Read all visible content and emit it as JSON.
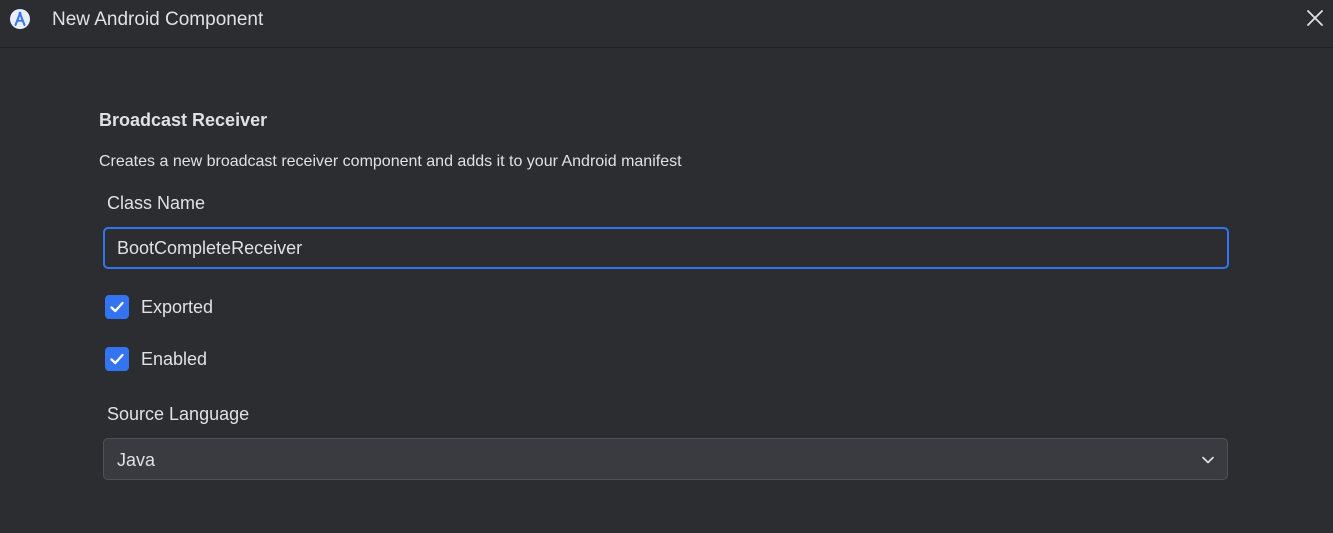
{
  "window": {
    "title": "New Android Component",
    "app_icon": "android-studio-icon",
    "close_icon": "close-icon"
  },
  "form": {
    "heading": "Broadcast Receiver",
    "description": "Creates a new broadcast receiver component and adds it to your Android manifest",
    "class_name_label": "Class Name",
    "class_name_value": "BootCompleteReceiver",
    "checkboxes": [
      {
        "label": "Exported",
        "checked": true
      },
      {
        "label": "Enabled",
        "checked": true
      }
    ],
    "source_language_label": "Source Language",
    "source_language_value": "Java"
  },
  "colors": {
    "background": "#2b2d30",
    "accent": "#3574f0",
    "text": "#dfe1e5",
    "select_bg": "#393b40"
  }
}
